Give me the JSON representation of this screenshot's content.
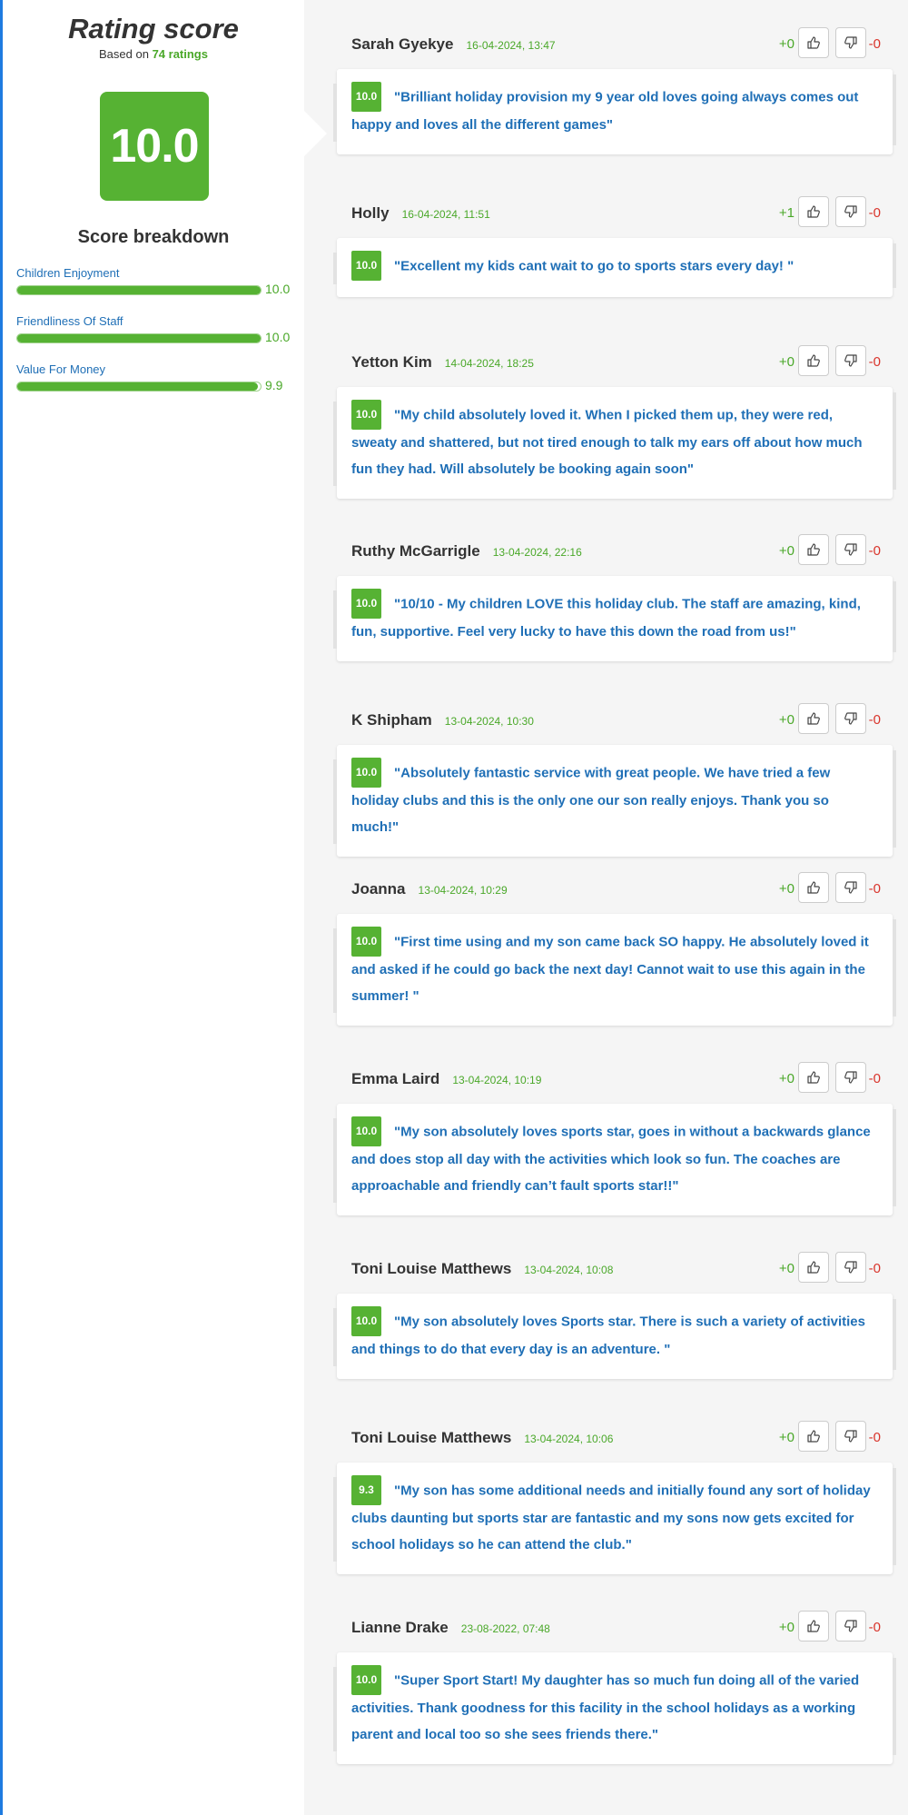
{
  "summary": {
    "title": "Rating score",
    "based_on_prefix": "Based on ",
    "ratings_count": "74 ratings",
    "score": "10.0",
    "breakdown_title": "Score breakdown",
    "breakdown": [
      {
        "label": "Children Enjoyment",
        "value": "10.0",
        "fill": 1.0
      },
      {
        "label": "Friendliness Of Staff",
        "value": "10.0",
        "fill": 1.0
      },
      {
        "label": "Value For Money",
        "value": "9.9",
        "fill": 0.99
      }
    ]
  },
  "reviews": [
    {
      "name": "Sarah Gyekye",
      "date": "16-04-2024, 13:47",
      "plus": "+0",
      "minus": "-0",
      "score": "10.0",
      "text": "\"Brilliant holiday provision my 9 year old loves going always comes out happy and loves all the different games\""
    },
    {
      "name": "Holly",
      "date": "16-04-2024, 11:51",
      "plus": "+1",
      "minus": "-0",
      "score": "10.0",
      "text": "\"Excellent my kids cant wait to go to sports stars every day! \""
    },
    {
      "name": "Yetton Kim",
      "date": "14-04-2024, 18:25",
      "plus": "+0",
      "minus": "-0",
      "score": "10.0",
      "text": "\"My child absolutely loved it. When I picked them up, they were red, sweaty and shattered, but not tired enough to talk my ears off about how much fun they had. Will absolutely be booking again soon\""
    },
    {
      "name": "Ruthy McGarrigle",
      "date": "13-04-2024, 22:16",
      "plus": "+0",
      "minus": "-0",
      "score": "10.0",
      "text": "\"10/10 - My children LOVE this holiday club. The staff are amazing, kind, fun, supportive. Feel very lucky to have this down the road from us!\""
    },
    {
      "name": "K Shipham",
      "date": "13-04-2024, 10:30",
      "plus": "+0",
      "minus": "-0",
      "score": "10.0",
      "text": "\"Absolutely fantastic service with great people. We have tried a few holiday clubs and this is the only one our son really enjoys. Thank you so much!\""
    },
    {
      "name": "Joanna",
      "date": "13-04-2024, 10:29",
      "plus": "+0",
      "minus": "-0",
      "score": "10.0",
      "text": "\"First time using and my son came back SO happy. He absolutely loved it and asked if he could go back the next day! Cannot wait to use this again in the summer! \""
    },
    {
      "name": "Emma Laird",
      "date": "13-04-2024, 10:19",
      "plus": "+0",
      "minus": "-0",
      "score": "10.0",
      "text": "\"My son absolutely loves sports star, goes in without a backwards glance and does stop all day with the activities which look so fun. The coaches are approachable and friendly can’t fault sports star!!\""
    },
    {
      "name": "Toni Louise Matthews",
      "date": "13-04-2024, 10:08",
      "plus": "+0",
      "minus": "-0",
      "score": "10.0",
      "text": "\"My son absolutely loves Sports star. There is such a variety of activities and things to do that every day is an adventure. \""
    },
    {
      "name": "Toni Louise Matthews",
      "date": "13-04-2024, 10:06",
      "plus": "+0",
      "minus": "-0",
      "score": "9.3",
      "text": "\"My son has some additional needs and initially found any sort of holiday clubs daunting but sports star are fantastic and my sons now gets excited for school holidays so he can attend the club.\""
    },
    {
      "name": "Lianne Drake",
      "date": "23-08-2022, 07:48",
      "plus": "+0",
      "minus": "-0",
      "score": "10.0",
      "text": "\"Super Sport Start! My daughter has so much fun doing all of the varied activities. Thank goodness for this facility in the school holidays as a working parent and local too so she sees friends there.\""
    }
  ]
}
